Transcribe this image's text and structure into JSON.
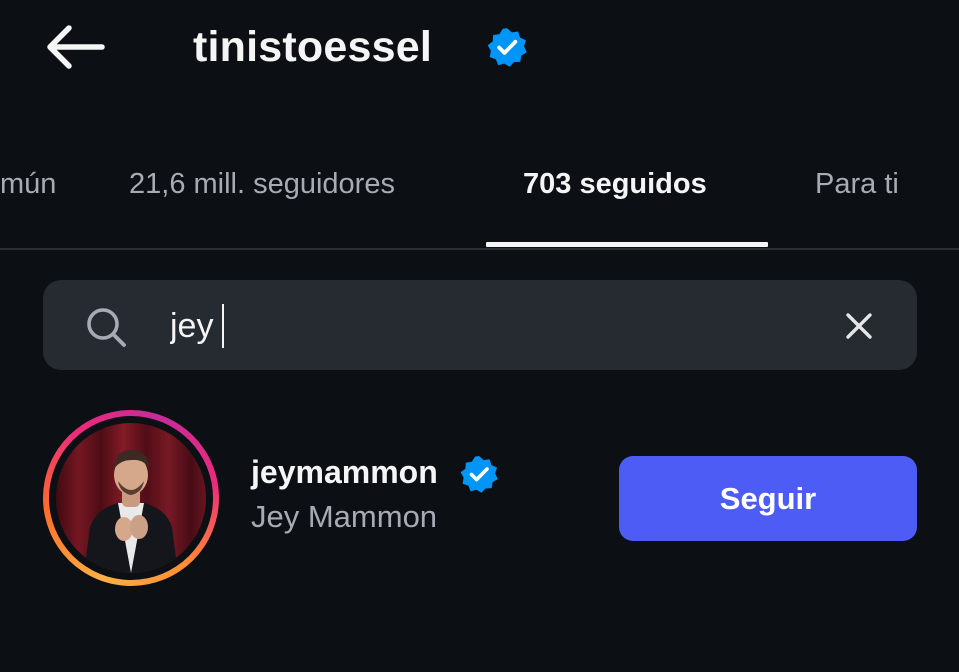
{
  "header": {
    "title": "tinistoessel",
    "verified": true
  },
  "tabs": [
    {
      "label": "mún",
      "active": false
    },
    {
      "label": "21,6 mill. seguidores",
      "active": false
    },
    {
      "label": "703 seguidos",
      "active": true
    },
    {
      "label": "Para ti",
      "active": false
    }
  ],
  "search": {
    "value": "jey",
    "icon": "search-icon",
    "clear_icon": "close-icon"
  },
  "results": [
    {
      "username": "jeymammon",
      "full_name": "Jey Mammon",
      "verified": true,
      "has_story_ring": true,
      "button_label": "Seguir"
    }
  ],
  "colors": {
    "background": "#0c0f14",
    "search_bg": "#262a31",
    "verified_blue": "#0095f6",
    "follow_button": "#4d5cf5",
    "muted_text": "#a7abb3"
  }
}
